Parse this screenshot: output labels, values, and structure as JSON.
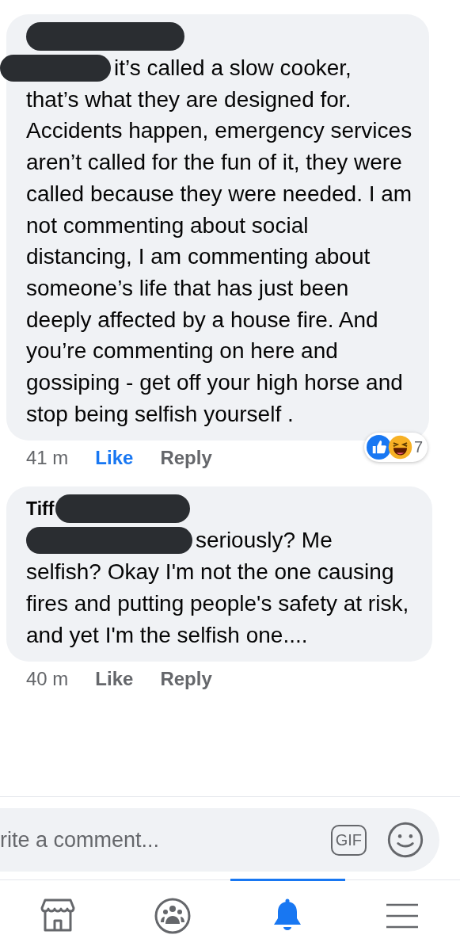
{
  "comments": [
    {
      "lead": "it’s called a slow cooker,",
      "text": "that’s what they are designed for. Accidents happen, emergency services aren’t called for the fun of it, they were called because they were needed. I am not commenting about social distancing, I am commenting about someone’s life that has just been deeply affected by a house fire. And you’re commenting on here and gossiping - get off your high horse and stop being selfish yourself .",
      "time": "41 m",
      "like": {
        "label": "Like",
        "selected": true
      },
      "reply": "Reply",
      "reactions": {
        "count": "7"
      }
    },
    {
      "author": "Tiff",
      "lead": "seriously? Me",
      "text": "selfish? Okay I'm not the one causing fires and putting people's safety at risk, and yet I'm the selfish one....",
      "time": "40 m",
      "like": {
        "label": "Like",
        "selected": false
      },
      "reply": "Reply"
    }
  ],
  "composer": {
    "placeholder": "rite a comment...",
    "gif": "GIF"
  },
  "tabs": [
    {
      "kind": "shop",
      "selected": false
    },
    {
      "kind": "groups",
      "selected": false
    },
    {
      "kind": "bell",
      "selected": true
    },
    {
      "kind": "menu",
      "selected": false
    }
  ]
}
